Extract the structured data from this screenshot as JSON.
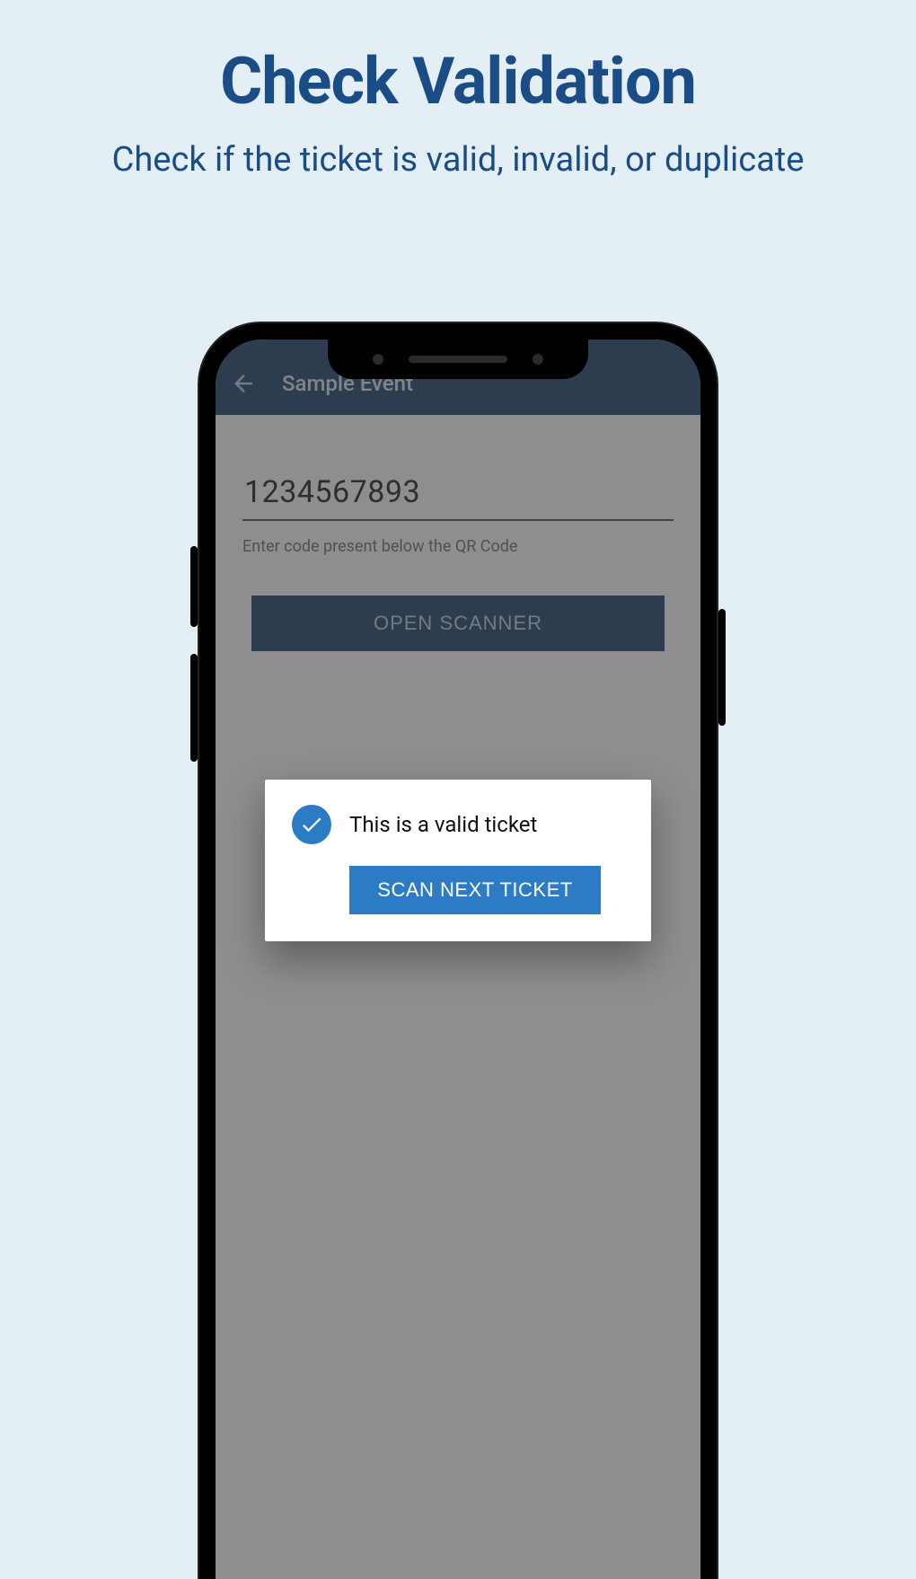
{
  "marketing": {
    "title": "Check Validation",
    "subtitle": "Check if the ticket is valid, invalid, or duplicate"
  },
  "appbar": {
    "title": "Sample Event"
  },
  "form": {
    "code_value": "1234567893",
    "helper_text": "Enter code present below the QR Code",
    "open_scanner_label": "OPEN SCANNER"
  },
  "dialog": {
    "message": "This is a valid ticket",
    "scan_next_label": "SCAN NEXT TICKET"
  },
  "colors": {
    "brand_dark": "#1b3f66",
    "brand_blue": "#2b7cc4",
    "page_bg": "#e4eef5"
  }
}
